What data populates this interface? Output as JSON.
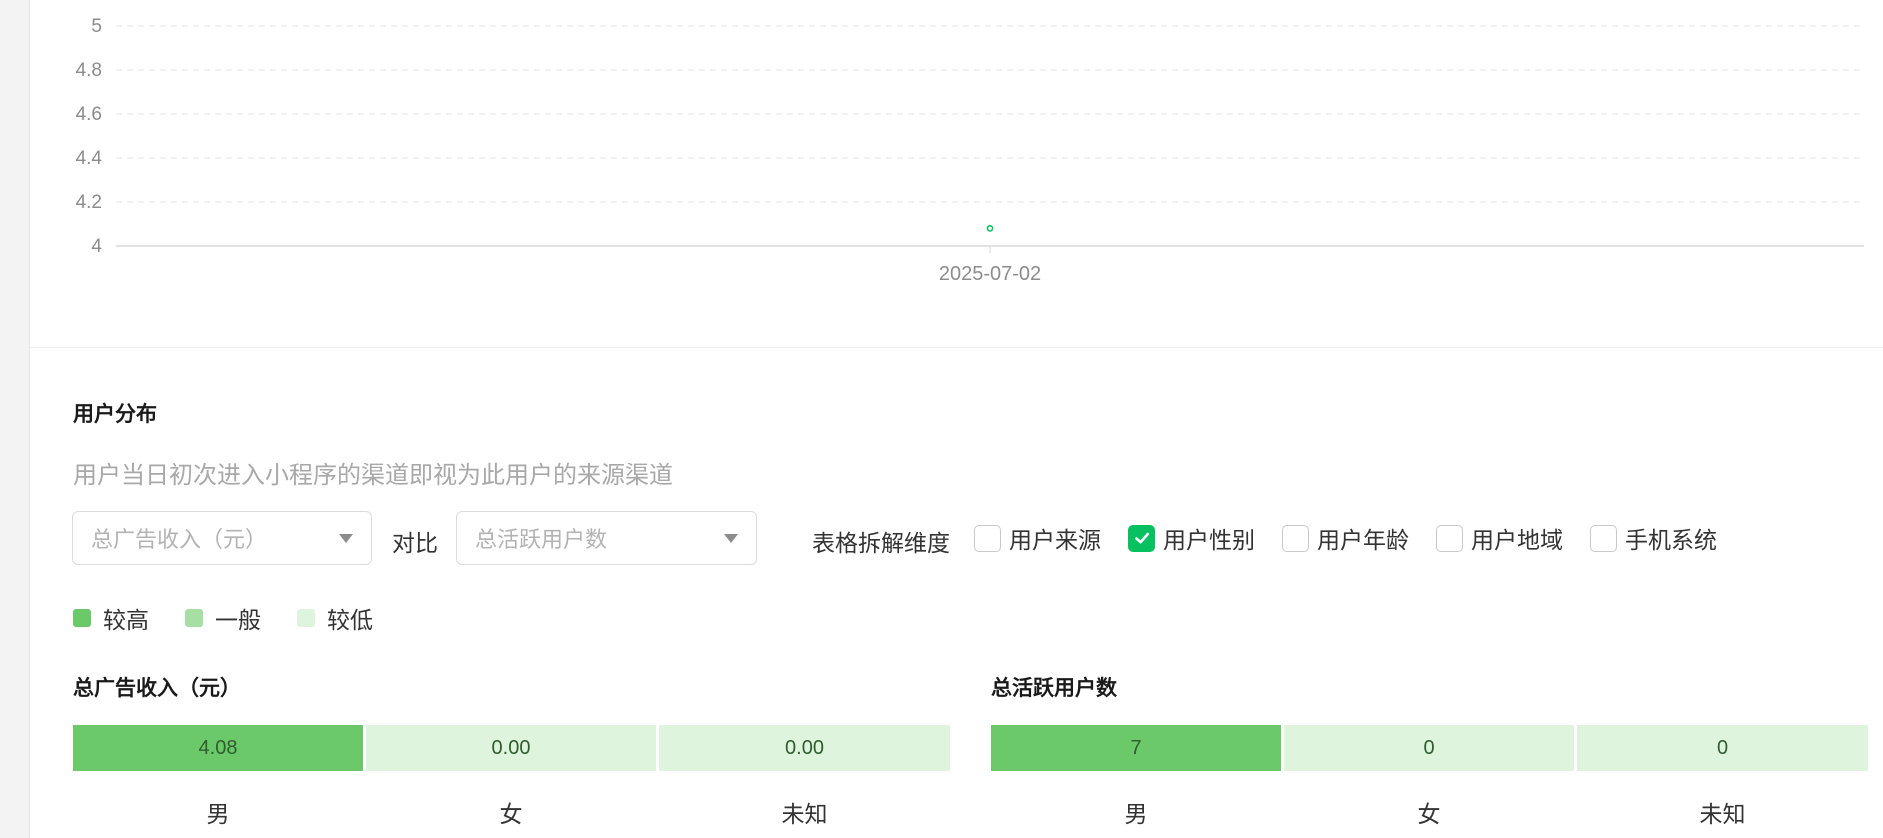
{
  "chart_data": {
    "type": "line",
    "x": [
      "2025-07-02"
    ],
    "series": [
      {
        "values": [
          4.08
        ],
        "color": "#07c160"
      }
    ],
    "yticks": [
      "4",
      "4.2",
      "4.4",
      "4.6",
      "4.8",
      "5"
    ],
    "ylim": [
      4,
      5
    ],
    "grid": true
  },
  "distribution": {
    "title": "用户分布",
    "description": "用户当日初次进入小程序的渠道即视为此用户的来源渠道",
    "select_a": {
      "placeholder": "总广告收入（元）"
    },
    "compare_label": "对比",
    "select_b": {
      "placeholder": "总活跃用户数"
    },
    "dimension_label": "表格拆解维度",
    "dimensions": [
      {
        "label": "用户来源",
        "checked": false
      },
      {
        "label": "用户性别",
        "checked": true
      },
      {
        "label": "用户年龄",
        "checked": false
      },
      {
        "label": "用户地域",
        "checked": false
      },
      {
        "label": "手机系统",
        "checked": false
      }
    ],
    "legend": [
      {
        "label": "较高",
        "color": "#6cc96a"
      },
      {
        "label": "一般",
        "color": "#a6dea3"
      },
      {
        "label": "较低",
        "color": "#def4dc"
      }
    ],
    "tables": [
      {
        "title": "总广告收入（元）",
        "values": [
          "4.08",
          "0.00",
          "0.00"
        ],
        "levels": [
          "high",
          "low",
          "low"
        ],
        "labels": [
          "男",
          "女",
          "未知"
        ]
      },
      {
        "title": "总活跃用户数",
        "values": [
          "7",
          "0",
          "0"
        ],
        "levels": [
          "high",
          "low",
          "low"
        ],
        "labels": [
          "男",
          "女",
          "未知"
        ]
      }
    ]
  }
}
